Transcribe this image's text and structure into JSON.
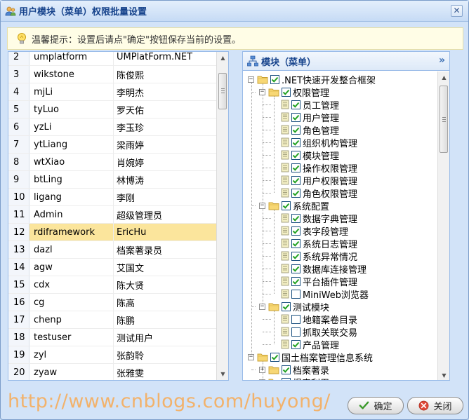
{
  "window": {
    "title": "用户模块（菜单）权限批量设置",
    "close_glyph": "✕"
  },
  "tip": {
    "text": "温馨提示：设置后请点\"确定\"按钮保存当前的设置。",
    "icon": "lightbulb-icon"
  },
  "users": {
    "rows": [
      {
        "idx": "2",
        "code": "umplatform",
        "name": "UMPlatForm.NET"
      },
      {
        "idx": "3",
        "code": "wikstone",
        "name": "陈俊熙"
      },
      {
        "idx": "4",
        "code": "mjLi",
        "name": "李明杰"
      },
      {
        "idx": "5",
        "code": "tyLuo",
        "name": "罗天佑"
      },
      {
        "idx": "6",
        "code": "yzLi",
        "name": "李玉珍"
      },
      {
        "idx": "7",
        "code": "ytLiang",
        "name": "梁雨婷"
      },
      {
        "idx": "8",
        "code": "wtXiao",
        "name": "肖婉婷"
      },
      {
        "idx": "9",
        "code": "btLing",
        "name": "林博涛"
      },
      {
        "idx": "10",
        "code": "ligang",
        "name": "李刚"
      },
      {
        "idx": "11",
        "code": "Admin",
        "name": "超级管理员"
      },
      {
        "idx": "12",
        "code": "rdiframework",
        "name": "EricHu",
        "selected": true
      },
      {
        "idx": "13",
        "code": "dazl",
        "name": "档案著录员"
      },
      {
        "idx": "14",
        "code": "agw",
        "name": "艾国文"
      },
      {
        "idx": "15",
        "code": "cdx",
        "name": "陈大贤"
      },
      {
        "idx": "16",
        "code": "cg",
        "name": "陈高"
      },
      {
        "idx": "17",
        "code": "chenp",
        "name": "陈鹏"
      },
      {
        "idx": "18",
        "code": "testuser",
        "name": "测试用户"
      },
      {
        "idx": "19",
        "code": "zyl",
        "name": "张韵聆"
      },
      {
        "idx": "20",
        "code": "zyaw",
        "name": "张雅雯"
      }
    ]
  },
  "tree": {
    "title": "模块（菜单）",
    "header_icon": "sitemap-icon",
    "collapse_glyph": "»",
    "nodes": [
      {
        "label": ".NET快速开发整合框架",
        "level": 0,
        "folder": true,
        "exp": "−",
        "checked": true
      },
      {
        "label": "权限管理",
        "level": 1,
        "folder": true,
        "exp": "−",
        "checked": true
      },
      {
        "label": "员工管理",
        "level": 2,
        "folder": false,
        "checked": true
      },
      {
        "label": "用户管理",
        "level": 2,
        "folder": false,
        "checked": true
      },
      {
        "label": "角色管理",
        "level": 2,
        "folder": false,
        "checked": true
      },
      {
        "label": "组织机构管理",
        "level": 2,
        "folder": false,
        "checked": true
      },
      {
        "label": "模块管理",
        "level": 2,
        "folder": false,
        "checked": true
      },
      {
        "label": "操作权限管理",
        "level": 2,
        "folder": false,
        "checked": true
      },
      {
        "label": "用户权限管理",
        "level": 2,
        "folder": false,
        "checked": true
      },
      {
        "label": "角色权限管理",
        "level": 2,
        "folder": false,
        "checked": true
      },
      {
        "label": "系统配置",
        "level": 1,
        "folder": true,
        "exp": "−",
        "checked": true
      },
      {
        "label": "数据字典管理",
        "level": 2,
        "folder": false,
        "checked": true
      },
      {
        "label": "表字段管理",
        "level": 2,
        "folder": false,
        "checked": true
      },
      {
        "label": "系统日志管理",
        "level": 2,
        "folder": false,
        "checked": true
      },
      {
        "label": "系统异常情况",
        "level": 2,
        "folder": false,
        "checked": true
      },
      {
        "label": "数据库连接管理",
        "level": 2,
        "folder": false,
        "checked": true
      },
      {
        "label": "平台插件管理",
        "level": 2,
        "folder": false,
        "checked": true
      },
      {
        "label": "MiniWeb浏览器",
        "level": 2,
        "folder": false,
        "checked": false
      },
      {
        "label": "测试模块",
        "level": 1,
        "folder": true,
        "exp": "−",
        "checked": true
      },
      {
        "label": "地籍案卷目录",
        "level": 2,
        "folder": false,
        "checked": false
      },
      {
        "label": "抓取关联交易",
        "level": 2,
        "folder": false,
        "checked": false
      },
      {
        "label": "产品管理",
        "level": 2,
        "folder": false,
        "checked": true
      },
      {
        "label": "国土档案管理信息系统",
        "level": 0,
        "folder": true,
        "exp": "−",
        "checked": true
      },
      {
        "label": "档案著录",
        "level": 1,
        "folder": true,
        "exp": "+",
        "checked": true
      },
      {
        "label": "报表利用",
        "level": 1,
        "folder": true,
        "exp": "+",
        "checked": true
      }
    ]
  },
  "footer": {
    "watermark": "http://www.cnblogs.com/huyong/",
    "ok_label": "确定",
    "close_label": "关闭",
    "ok_icon": "checkmark-icon",
    "close_icon": "close-circle-icon"
  },
  "colors": {
    "selected_row": "#fbe59c",
    "title_text": "#15428b",
    "panel_border": "#99bbe8",
    "watermark": "#f2b26b"
  }
}
